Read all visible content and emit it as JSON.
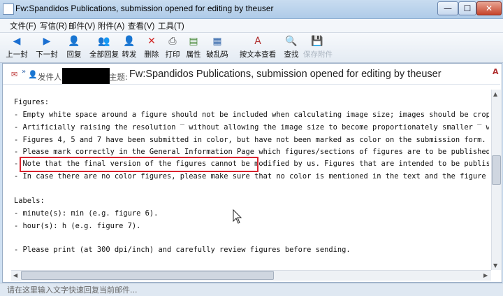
{
  "window": {
    "title": "Fw:Spandidos Publications, submission opened for editing by theuser",
    "controls": {
      "minimize": "—",
      "maximize": "☐",
      "close": "✕"
    }
  },
  "menu": {
    "items": [
      "文件(F)",
      "写信(R)",
      "邮件(V)",
      "附件(A)",
      "查看(V)",
      "工具(T)"
    ]
  },
  "toolbar": {
    "buttons": [
      {
        "label": "上一封",
        "icon": "prev-message-icon",
        "glyph": "◀",
        "color": "#1b6fd1"
      },
      {
        "label": "下一封",
        "icon": "next-message-icon",
        "glyph": "▶",
        "color": "#1b6fd1"
      },
      {
        "label": "回复",
        "icon": "reply-icon",
        "glyph": "👤",
        "color": "#2a7d3a"
      },
      {
        "label": "全部回复",
        "icon": "reply-all-icon",
        "glyph": "👥",
        "color": "#2a7d3a"
      },
      {
        "label": "转发",
        "icon": "forward-icon",
        "glyph": "👤",
        "color": "#c77a17"
      },
      {
        "label": "删除",
        "icon": "delete-icon",
        "glyph": "✕",
        "color": "#d22b2b"
      },
      {
        "label": "打印",
        "icon": "print-icon",
        "glyph": "⎙",
        "color": "#555555"
      },
      {
        "label": "属性",
        "icon": "properties-icon",
        "glyph": "▤",
        "color": "#4a8a3a"
      },
      {
        "label": "破乱码",
        "icon": "decode-icon",
        "glyph": "▦",
        "color": "#3366aa"
      },
      {
        "label": "按文本查看",
        "icon": "text-view-icon",
        "glyph": "A",
        "color": "#b03030"
      },
      {
        "label": "查找",
        "icon": "find-icon",
        "glyph": "🔍",
        "color": "#555555"
      },
      {
        "label": "保存附件",
        "icon": "save-attachment-icon",
        "glyph": "💾",
        "color": "#aab4c0"
      }
    ]
  },
  "header": {
    "sender_label": "发件人",
    "subject_label": "主题:",
    "subject": "Fw:Spandidos Publications, submission opened for editing by theuser"
  },
  "body": {
    "lines": [
      "Figures:",
      "- Empty white space around a figure should not be included when calculating image size; images should be cropped (cut) as close to the outs",
      "- Artificially raising the resolution ‾ without allowing the image size to become proportionately smaller ‾ will result in poor quality f",
      "- Figures 4, 5 and 7 have been submitted in color, but have not been marked as color on the submission form.",
      "- Please mark correctly in the General Information Page which figures/sections of figures are to be published in color and which are to be",
      "- Note that the final version of the figures cannot be modified by us. Figures that are intended to be published in black and white, should",
      "- In case there are no color figures, please make sure that no color is mentioned in the text and the figure legends.",
      "",
      "Labels:",
      "- minute(s): min (e.g. figure 6).",
      "- hour(s): h (e.g. figure 7).",
      "",
      "- Please print (at 300 dpi/inch) and carefully review figures before sending."
    ]
  },
  "status": {
    "quick_reply_placeholder": "请在这里输入文字快速回复当前邮件..."
  },
  "colors": {
    "highlight_border": "#d9232e"
  }
}
